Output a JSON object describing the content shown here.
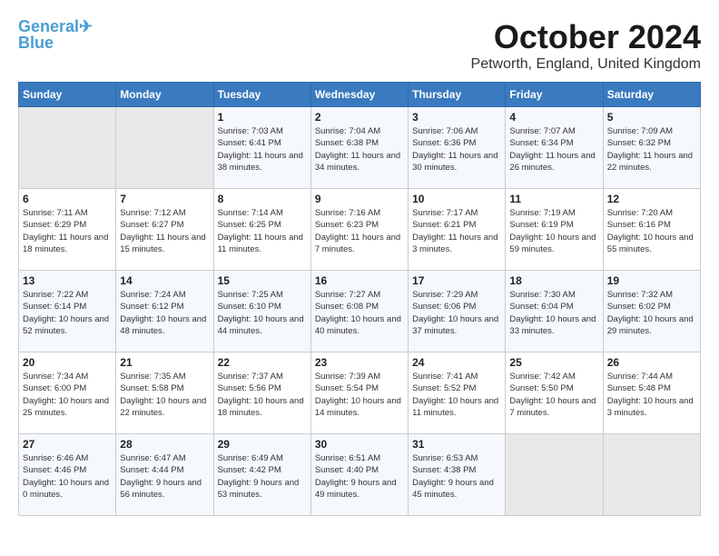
{
  "header": {
    "logo_line1": "General",
    "logo_line2": "Blue",
    "month": "October 2024",
    "location": "Petworth, England, United Kingdom"
  },
  "weekdays": [
    "Sunday",
    "Monday",
    "Tuesday",
    "Wednesday",
    "Thursday",
    "Friday",
    "Saturday"
  ],
  "weeks": [
    [
      {
        "day": "",
        "empty": true
      },
      {
        "day": "",
        "empty": true
      },
      {
        "day": "1",
        "sunrise": "Sunrise: 7:03 AM",
        "sunset": "Sunset: 6:41 PM",
        "daylight": "Daylight: 11 hours and 38 minutes."
      },
      {
        "day": "2",
        "sunrise": "Sunrise: 7:04 AM",
        "sunset": "Sunset: 6:38 PM",
        "daylight": "Daylight: 11 hours and 34 minutes."
      },
      {
        "day": "3",
        "sunrise": "Sunrise: 7:06 AM",
        "sunset": "Sunset: 6:36 PM",
        "daylight": "Daylight: 11 hours and 30 minutes."
      },
      {
        "day": "4",
        "sunrise": "Sunrise: 7:07 AM",
        "sunset": "Sunset: 6:34 PM",
        "daylight": "Daylight: 11 hours and 26 minutes."
      },
      {
        "day": "5",
        "sunrise": "Sunrise: 7:09 AM",
        "sunset": "Sunset: 6:32 PM",
        "daylight": "Daylight: 11 hours and 22 minutes."
      }
    ],
    [
      {
        "day": "6",
        "sunrise": "Sunrise: 7:11 AM",
        "sunset": "Sunset: 6:29 PM",
        "daylight": "Daylight: 11 hours and 18 minutes."
      },
      {
        "day": "7",
        "sunrise": "Sunrise: 7:12 AM",
        "sunset": "Sunset: 6:27 PM",
        "daylight": "Daylight: 11 hours and 15 minutes."
      },
      {
        "day": "8",
        "sunrise": "Sunrise: 7:14 AM",
        "sunset": "Sunset: 6:25 PM",
        "daylight": "Daylight: 11 hours and 11 minutes."
      },
      {
        "day": "9",
        "sunrise": "Sunrise: 7:16 AM",
        "sunset": "Sunset: 6:23 PM",
        "daylight": "Daylight: 11 hours and 7 minutes."
      },
      {
        "day": "10",
        "sunrise": "Sunrise: 7:17 AM",
        "sunset": "Sunset: 6:21 PM",
        "daylight": "Daylight: 11 hours and 3 minutes."
      },
      {
        "day": "11",
        "sunrise": "Sunrise: 7:19 AM",
        "sunset": "Sunset: 6:19 PM",
        "daylight": "Daylight: 10 hours and 59 minutes."
      },
      {
        "day": "12",
        "sunrise": "Sunrise: 7:20 AM",
        "sunset": "Sunset: 6:16 PM",
        "daylight": "Daylight: 10 hours and 55 minutes."
      }
    ],
    [
      {
        "day": "13",
        "sunrise": "Sunrise: 7:22 AM",
        "sunset": "Sunset: 6:14 PM",
        "daylight": "Daylight: 10 hours and 52 minutes."
      },
      {
        "day": "14",
        "sunrise": "Sunrise: 7:24 AM",
        "sunset": "Sunset: 6:12 PM",
        "daylight": "Daylight: 10 hours and 48 minutes."
      },
      {
        "day": "15",
        "sunrise": "Sunrise: 7:25 AM",
        "sunset": "Sunset: 6:10 PM",
        "daylight": "Daylight: 10 hours and 44 minutes."
      },
      {
        "day": "16",
        "sunrise": "Sunrise: 7:27 AM",
        "sunset": "Sunset: 6:08 PM",
        "daylight": "Daylight: 10 hours and 40 minutes."
      },
      {
        "day": "17",
        "sunrise": "Sunrise: 7:29 AM",
        "sunset": "Sunset: 6:06 PM",
        "daylight": "Daylight: 10 hours and 37 minutes."
      },
      {
        "day": "18",
        "sunrise": "Sunrise: 7:30 AM",
        "sunset": "Sunset: 6:04 PM",
        "daylight": "Daylight: 10 hours and 33 minutes."
      },
      {
        "day": "19",
        "sunrise": "Sunrise: 7:32 AM",
        "sunset": "Sunset: 6:02 PM",
        "daylight": "Daylight: 10 hours and 29 minutes."
      }
    ],
    [
      {
        "day": "20",
        "sunrise": "Sunrise: 7:34 AM",
        "sunset": "Sunset: 6:00 PM",
        "daylight": "Daylight: 10 hours and 25 minutes."
      },
      {
        "day": "21",
        "sunrise": "Sunrise: 7:35 AM",
        "sunset": "Sunset: 5:58 PM",
        "daylight": "Daylight: 10 hours and 22 minutes."
      },
      {
        "day": "22",
        "sunrise": "Sunrise: 7:37 AM",
        "sunset": "Sunset: 5:56 PM",
        "daylight": "Daylight: 10 hours and 18 minutes."
      },
      {
        "day": "23",
        "sunrise": "Sunrise: 7:39 AM",
        "sunset": "Sunset: 5:54 PM",
        "daylight": "Daylight: 10 hours and 14 minutes."
      },
      {
        "day": "24",
        "sunrise": "Sunrise: 7:41 AM",
        "sunset": "Sunset: 5:52 PM",
        "daylight": "Daylight: 10 hours and 11 minutes."
      },
      {
        "day": "25",
        "sunrise": "Sunrise: 7:42 AM",
        "sunset": "Sunset: 5:50 PM",
        "daylight": "Daylight: 10 hours and 7 minutes."
      },
      {
        "day": "26",
        "sunrise": "Sunrise: 7:44 AM",
        "sunset": "Sunset: 5:48 PM",
        "daylight": "Daylight: 10 hours and 3 minutes."
      }
    ],
    [
      {
        "day": "27",
        "sunrise": "Sunrise: 6:46 AM",
        "sunset": "Sunset: 4:46 PM",
        "daylight": "Daylight: 10 hours and 0 minutes."
      },
      {
        "day": "28",
        "sunrise": "Sunrise: 6:47 AM",
        "sunset": "Sunset: 4:44 PM",
        "daylight": "Daylight: 9 hours and 56 minutes."
      },
      {
        "day": "29",
        "sunrise": "Sunrise: 6:49 AM",
        "sunset": "Sunset: 4:42 PM",
        "daylight": "Daylight: 9 hours and 53 minutes."
      },
      {
        "day": "30",
        "sunrise": "Sunrise: 6:51 AM",
        "sunset": "Sunset: 4:40 PM",
        "daylight": "Daylight: 9 hours and 49 minutes."
      },
      {
        "day": "31",
        "sunrise": "Sunrise: 6:53 AM",
        "sunset": "Sunset: 4:38 PM",
        "daylight": "Daylight: 9 hours and 45 minutes."
      },
      {
        "day": "",
        "empty": true
      },
      {
        "day": "",
        "empty": true
      }
    ]
  ]
}
